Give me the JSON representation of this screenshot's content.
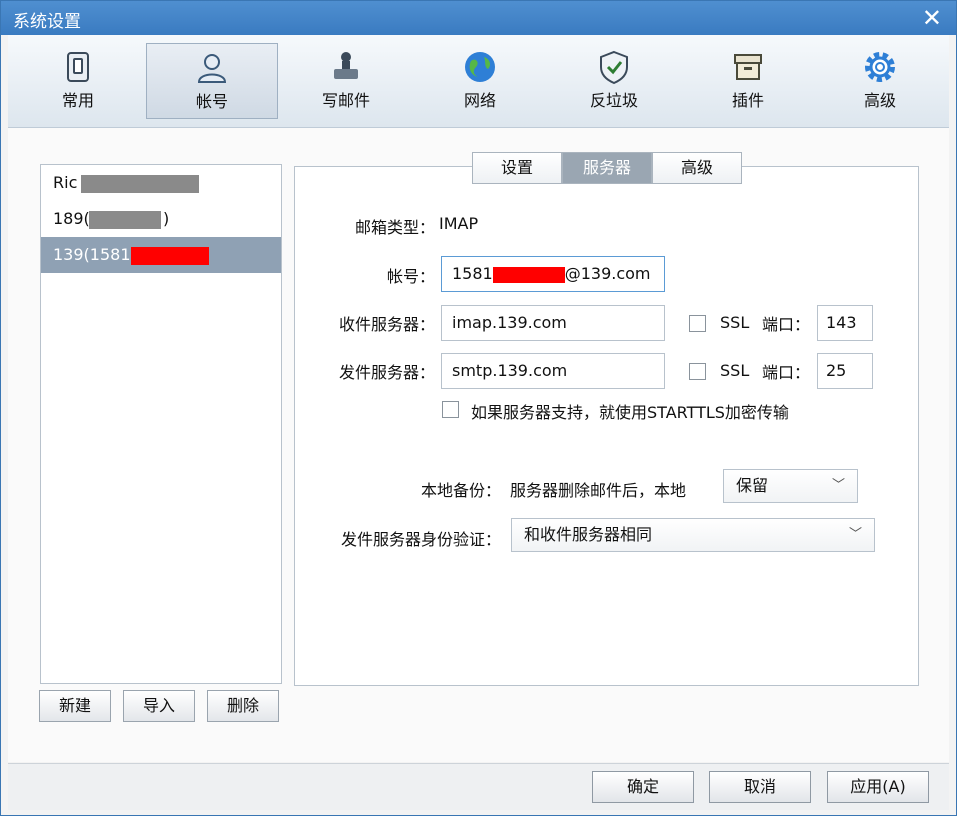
{
  "window": {
    "title": "系统设置"
  },
  "toolbar": {
    "items": [
      {
        "label": "常用",
        "icon": "switch-icon"
      },
      {
        "label": "帐号",
        "icon": "user-icon"
      },
      {
        "label": "写邮件",
        "icon": "stamp-icon"
      },
      {
        "label": "网络",
        "icon": "globe-icon"
      },
      {
        "label": "反垃圾",
        "icon": "shield-icon"
      },
      {
        "label": "插件",
        "icon": "box-icon"
      },
      {
        "label": "高级",
        "icon": "gear-icon"
      }
    ]
  },
  "accounts": [
    {
      "label": "Ric"
    },
    {
      "label": "189(",
      "suffix": ")"
    },
    {
      "label": "139(1581"
    }
  ],
  "account_buttons": {
    "new": "新建",
    "import": "导入",
    "delete": "删除"
  },
  "tabs": [
    "设置",
    "服务器",
    "高级"
  ],
  "server": {
    "mailbox_type_label": "邮箱类型：",
    "mailbox_type": "IMAP",
    "account_label": "帐号：",
    "account_prefix": "1581",
    "account_suffix": "@139.com",
    "incoming_label": "收件服务器：",
    "incoming_value": "imap.139.com",
    "outgoing_label": "发件服务器：",
    "outgoing_value": "smtp.139.com",
    "ssl_label": "SSL",
    "port_label": "端口：",
    "incoming_port": "143",
    "outgoing_port": "25",
    "starttls_label": "如果服务器支持，就使用STARTTLS加密传输",
    "backup_label": "本地备份：",
    "backup_text": "服务器删除邮件后，本地",
    "backup_value": "保留",
    "auth_label": "发件服务器身份验证：",
    "auth_value": "和收件服务器相同"
  },
  "footer": {
    "ok": "确定",
    "cancel": "取消",
    "apply": "应用(A)"
  },
  "colors": {
    "title_bar": "#3a7bc1",
    "selected_row": "#8fa1b4",
    "mask_gray": "#8a8a8a",
    "mask_red": "#ff0000"
  }
}
